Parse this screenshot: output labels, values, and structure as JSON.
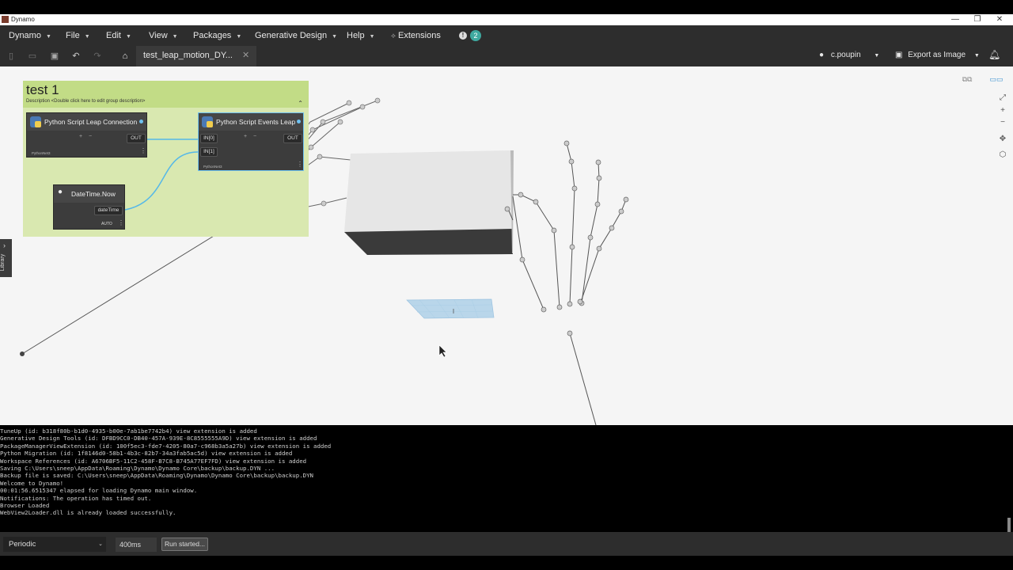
{
  "window": {
    "title": "Dynamo",
    "controls": [
      "—",
      "❐",
      "✕"
    ]
  },
  "menu": {
    "items": [
      {
        "label": "Dynamo"
      },
      {
        "label": "File"
      },
      {
        "label": "Edit"
      },
      {
        "label": "View"
      },
      {
        "label": "Packages"
      },
      {
        "label": "Generative Design"
      },
      {
        "label": "Help"
      }
    ],
    "extensions_label": "Extensions",
    "notification_count": "2",
    "info_glyph": "!"
  },
  "toolbar": {
    "file_tab": "test_leap_motion_DY...",
    "close_glyph": "✕",
    "user": "c.poupin",
    "export_label": "Export as Image",
    "caret": "▼"
  },
  "group": {
    "title": "test 1",
    "description": "Description <Double click here to edit group description>",
    "collapse_glyph": "⌃"
  },
  "nodes": {
    "leap_connection": {
      "title": "Python Script Leap Connection",
      "out": "OUT",
      "footer": "PythonNet3",
      "plus": "+",
      "minus": "−"
    },
    "events_leap": {
      "title": "Python Script Events Leap",
      "in0": "IN[0]",
      "in1": "IN[1]",
      "out": "OUT",
      "footer": "PythonNet3",
      "plus": "+",
      "minus": "−"
    },
    "datetime_now": {
      "title": "DateTime.Now",
      "out": "dateTime",
      "footer": "AUTO"
    }
  },
  "library": {
    "label": "Library",
    "arrow": "›"
  },
  "console": {
    "lines": [
      "TuneUp (id: b318f80b-b1d0-4935-b00e-7ab1be7742b4) view extension is added",
      "Generative Design Tools (id: DFBD9CC0-DB40-457A-939E-8C8555555A9D) view extension is added",
      "PackageManagerViewExtension (id: 100f5ec3-fde7-4205-80a7-c968b3a5a27b) view extension is added",
      "Python Migration (id: 1f8146d0-58b1-4b3c-82b7-34a3fab5ac5d) view extension is added",
      "Workspace References (id: A6706BF5-11C2-458F-B7C8-B745A77EF7FD) view extension is added",
      "Saving C:\\Users\\sneep\\AppData\\Roaming\\Dynamo\\Dynamo Core\\backup\\backup.DYN ...",
      "Backup file is saved: C:\\Users\\sneep\\AppData\\Roaming\\Dynamo\\Dynamo Core\\backup\\backup.DYN",
      "",
      "Welcome to Dynamo!",
      "00:01:56.6515347 elapsed for loading Dynamo main window.",
      "Notifications: The operation has timed out.",
      "Browser Loaded",
      "WebView2Loader.dll is already loaded successfully."
    ]
  },
  "runbar": {
    "mode": "Periodic",
    "interval": "400ms",
    "status": "Run started..."
  },
  "icons": {
    "new": "new-file-icon",
    "open": "open-icon",
    "save": "save-icon",
    "undo": "undo-icon",
    "redo": "redo-icon",
    "home": "home-icon",
    "user": "user-icon",
    "export": "export-icon",
    "bell": "bell-icon",
    "python": "python-icon"
  },
  "colors": {
    "group_head": "#c2dc86",
    "group_body": "#d9e8b0",
    "node_bg": "#3c3c3c",
    "wire": "#55b8e8",
    "accent_badge": "#3fa9a0",
    "canvas": "#f5f5f5"
  }
}
